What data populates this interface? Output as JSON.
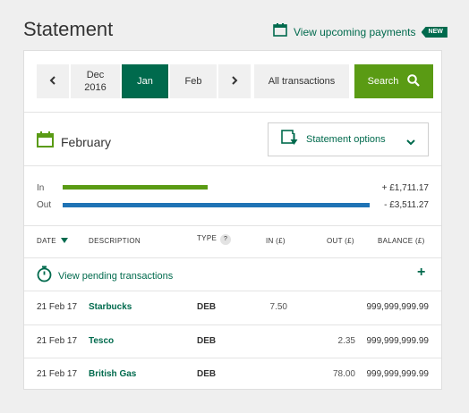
{
  "header": {
    "title": "Statement",
    "upcoming_label": "View upcoming payments",
    "new_badge": "NEW"
  },
  "nav": {
    "prev_icon": "chevron-left-icon",
    "months": [
      {
        "label_line1": "Dec",
        "label_line2": "2016"
      },
      {
        "label": "Jan",
        "selected": true
      },
      {
        "label": "Feb"
      }
    ],
    "next_icon": "chevron-right-icon",
    "all_label": "All transactions",
    "search_label": "Search"
  },
  "statement": {
    "month_label": "February",
    "options_label": "Statement options"
  },
  "flow": {
    "in_label": "In",
    "in_amount": "+ £1,711.17",
    "out_label": "Out",
    "out_amount": "- £3,511.27",
    "in_color": "#5a9b14",
    "out_color": "#1f73b5"
  },
  "table": {
    "headers": {
      "date": "DATE",
      "description": "DESCRIPTION",
      "type": "TYPE",
      "help": "?",
      "in": "IN (£)",
      "out": "OUT (£)",
      "balance": "BALANCE (£)"
    },
    "pending_label": "View pending transactions",
    "rows": [
      {
        "date": "21 Feb 17",
        "description": "Starbucks",
        "type": "DEB",
        "in": "7.50",
        "out": "",
        "balance": "999,999,999.99"
      },
      {
        "date": "21 Feb 17",
        "description": "Tesco",
        "type": "DEB",
        "in": "",
        "out": "2.35",
        "balance": "999,999,999.99"
      },
      {
        "date": "21 Feb 17",
        "description": "British Gas",
        "type": "DEB",
        "in": "",
        "out": "78.00",
        "balance": "999,999,999.99"
      }
    ]
  },
  "colors": {
    "brand_green": "#006a4d",
    "accent_green": "#5a9b14",
    "accent_blue": "#1f73b5"
  }
}
